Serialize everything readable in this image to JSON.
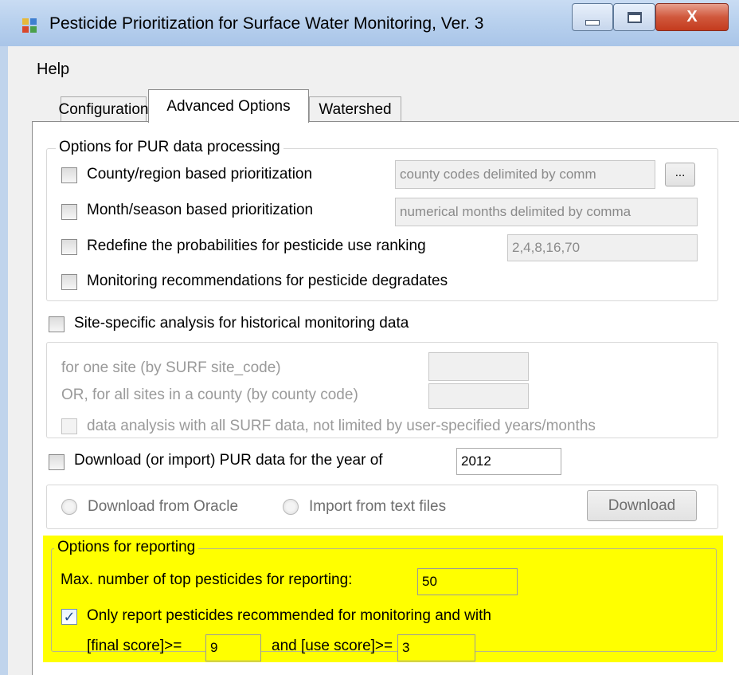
{
  "window": {
    "title": "Pesticide Prioritization for Surface Water Monitoring, Ver. 3",
    "close_glyph": "X"
  },
  "menu": {
    "help": "Help"
  },
  "tabs": [
    {
      "label": "Configuration",
      "selected": false
    },
    {
      "label": "Advanced Options",
      "selected": true
    },
    {
      "label": "Watershed",
      "selected": false
    }
  ],
  "pur_options": {
    "legend": "Options for PUR data processing",
    "county_label": "County/region based prioritization",
    "county_placeholder": "county codes delimited by comm",
    "browse_label": "...",
    "month_label": "Month/season based prioritization",
    "month_placeholder": "numerical months delimited by comma",
    "prob_label": "Redefine the probabilities for pesticide use ranking",
    "prob_value": "2,4,8,16,70",
    "degradates_label": "Monitoring recommendations for pesticide degradates"
  },
  "site_analysis": {
    "label": "Site-specific analysis for historical monitoring data",
    "one_site_label": "for one site (by SURF site_code)",
    "county_sites_label": "OR, for all sites in a county (by county code)",
    "all_data_label": "data analysis with all SURF data, not limited by user-specified years/months"
  },
  "download": {
    "label": "Download (or import) PUR data for the year of",
    "year": "2012",
    "oracle_label": "Download from Oracle",
    "text_files_label": "Import from text files",
    "button_label": "Download"
  },
  "reporting": {
    "legend": "Options for reporting",
    "max_label": "Max. number of top pesticides for reporting:",
    "max_value": "50",
    "only_report_label": "Only report pesticides recommended for monitoring and with",
    "only_report_checked": true,
    "final_score_label": "[final score]>=",
    "final_score_value": "9",
    "use_score_label": "and [use score]>=",
    "use_score_value": "3",
    "highlight_color": "#ffff00"
  },
  "colors": {
    "titlebar": "#b9d1ee",
    "close_button": "#c43b1e",
    "disabled_text": "#9a9a9a"
  }
}
